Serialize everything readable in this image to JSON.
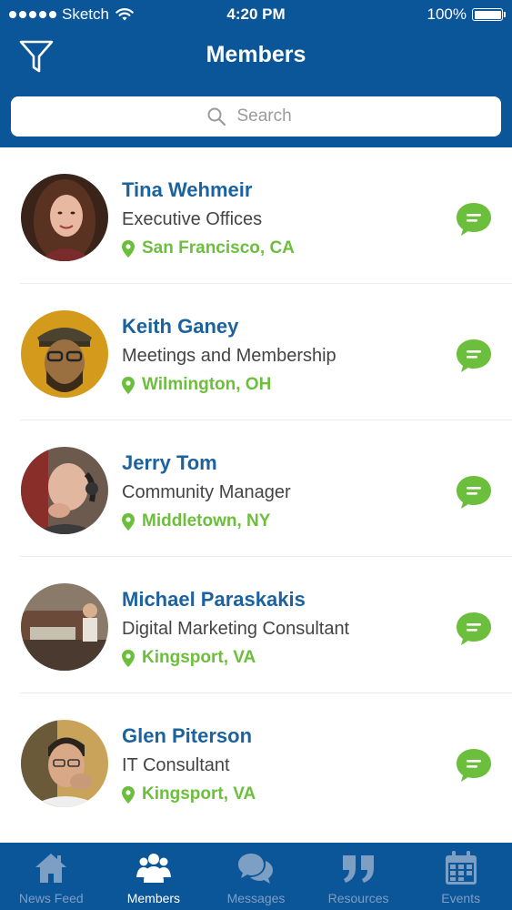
{
  "status_bar": {
    "carrier": "Sketch",
    "time": "4:20 PM",
    "battery": "100%"
  },
  "header": {
    "title": "Members"
  },
  "search": {
    "placeholder": "Search"
  },
  "members": [
    {
      "name": "Tina Wehmeir",
      "role": "Executive Offices",
      "location": "San Francisco, CA"
    },
    {
      "name": "Keith Ganey",
      "role": "Meetings and Membership",
      "location": "Wilmington, OH"
    },
    {
      "name": "Jerry Tom",
      "role": "Community Manager",
      "location": "Middletown, NY"
    },
    {
      "name": "Michael Paraskakis",
      "role": "Digital Marketing Consultant",
      "location": "Kingsport, VA"
    },
    {
      "name": "Glen Piterson",
      "role": "IT Consultant",
      "location": "Kingsport, VA"
    }
  ],
  "tabs": [
    {
      "label": "News Feed",
      "icon": "home-icon"
    },
    {
      "label": "Members",
      "icon": "members-icon",
      "active": true
    },
    {
      "label": "Messages",
      "icon": "messages-icon"
    },
    {
      "label": "Resources",
      "icon": "quote-icon"
    },
    {
      "label": "Events",
      "icon": "calendar-icon"
    }
  ],
  "colors": {
    "header": "#0b5599",
    "name": "#1b629e",
    "location": "#6cbf3c",
    "tab_inactive": "#7e9fc4",
    "tab_active": "#ffffff"
  }
}
